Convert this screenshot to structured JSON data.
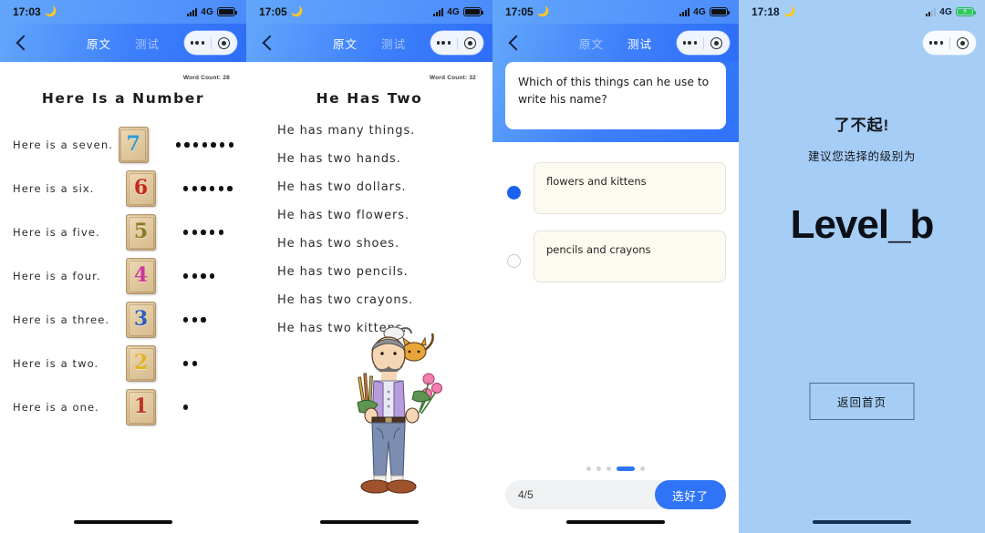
{
  "screen1": {
    "status": {
      "time": "17:03",
      "moon": "🌙",
      "network": "4G"
    },
    "nav": {
      "back": "back-arrow",
      "tab_original": "原文",
      "tab_test": "测试",
      "active_tab": "原文"
    },
    "reader": {
      "word_count": "Word Count: 28",
      "title": "Here Is a Number",
      "rows": [
        {
          "sentence": "Here is a seven.",
          "number": "7",
          "color": "#2f9bd6",
          "dots": 7
        },
        {
          "sentence": "Here is a six.",
          "number": "6",
          "color": "#c32a22",
          "dots": 6
        },
        {
          "sentence": "Here is a five.",
          "number": "5",
          "color": "#8a7a23",
          "dots": 5
        },
        {
          "sentence": "Here is a four.",
          "number": "4",
          "color": "#c73a9a",
          "dots": 4
        },
        {
          "sentence": "Here is a three.",
          "number": "3",
          "color": "#2f5fc0",
          "dots": 3
        },
        {
          "sentence": "Here is a two.",
          "number": "2",
          "color": "#e0b324",
          "dots": 2
        },
        {
          "sentence": "Here is a one.",
          "number": "1",
          "color": "#bf3526",
          "dots": 1
        }
      ]
    }
  },
  "screen2": {
    "status": {
      "time": "17:05",
      "moon": "🌙",
      "network": "4G"
    },
    "nav": {
      "back": "back-arrow",
      "tab_original": "原文",
      "tab_test": "测试",
      "active_tab": "原文"
    },
    "reader": {
      "word_count": "Word Count: 32",
      "title": "He Has Two",
      "lines": [
        "He has many things.",
        "He has two hands.",
        "He has two dollars.",
        "He has two flowers.",
        "He has two shoes.",
        "He has two pencils.",
        "He has two crayons.",
        "He has two kittens."
      ],
      "illustration": "man-with-pencils-flowers-and-kittens"
    }
  },
  "screen3": {
    "status": {
      "time": "17:05",
      "moon": "🌙",
      "network": "4G"
    },
    "nav": {
      "back": "back-arrow",
      "tab_original": "原文",
      "tab_test": "测试",
      "active_tab": "测试"
    },
    "quiz": {
      "question": "Which of this things can he use to write his name?",
      "options": [
        {
          "label": "flowers and kittens",
          "selected": true
        },
        {
          "label": "pencils and crayons",
          "selected": false
        }
      ],
      "page_dots": {
        "count": 5,
        "active_index": 3
      },
      "progress": "4/5",
      "submit_label": "选好了"
    }
  },
  "screen4": {
    "status": {
      "time": "17:18",
      "moon": "🌙",
      "network": "4G",
      "charging": true
    },
    "result": {
      "congrats": "了不起!",
      "subtitle": "建议您选择的级别为",
      "level": "Level_b",
      "home_button": "返回首页"
    }
  },
  "colors": {
    "header_blue": "#3d7ffb",
    "accent_blue": "#2f74f6",
    "result_bg": "#a5cdf5",
    "option_bg": "#fdfbef"
  }
}
